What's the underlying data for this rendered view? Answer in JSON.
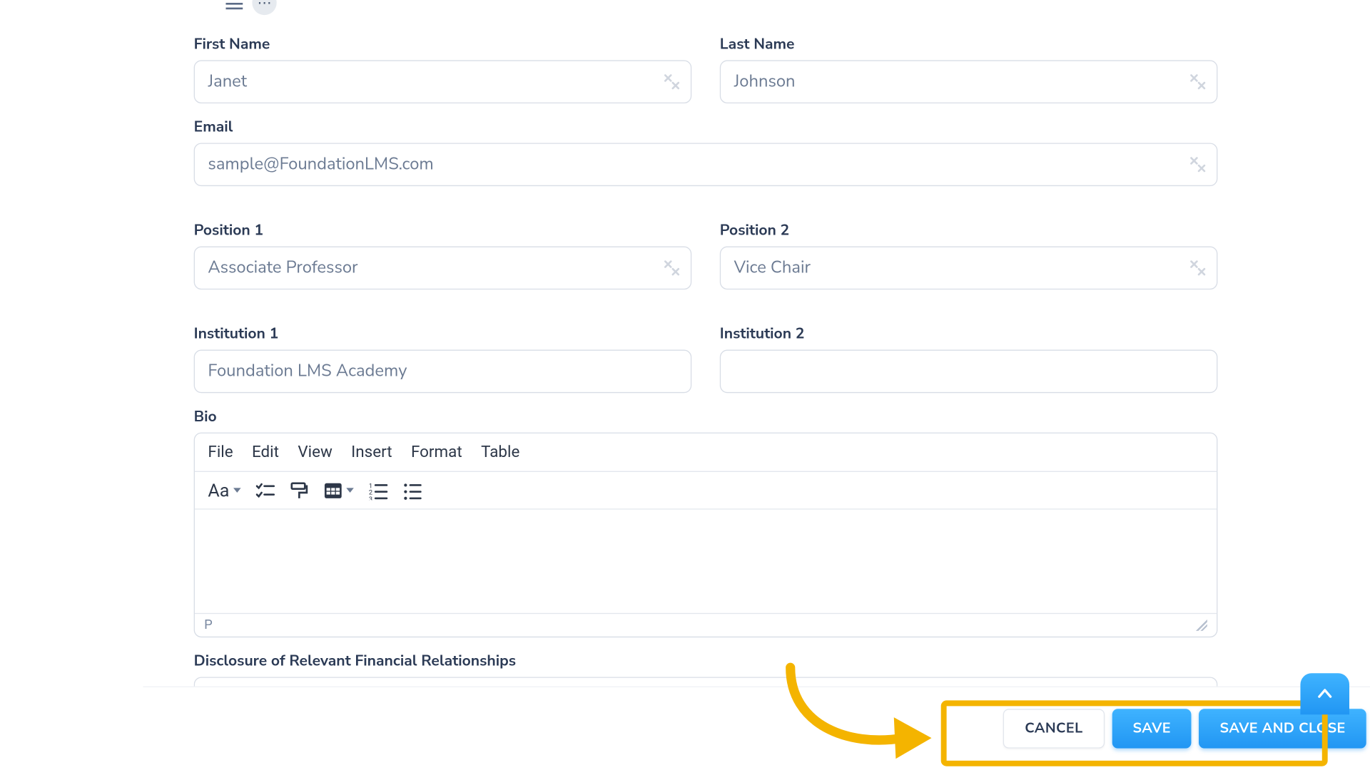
{
  "form": {
    "first_name": {
      "label": "First Name",
      "value": "Janet"
    },
    "last_name": {
      "label": "Last Name",
      "value": "Johnson"
    },
    "email": {
      "label": "Email",
      "value": "sample@FoundationLMS.com"
    },
    "position1": {
      "label": "Position 1",
      "value": "Associate Professor"
    },
    "position2": {
      "label": "Position 2",
      "value": "Vice Chair"
    },
    "institution1": {
      "label": "Institution 1",
      "value": "Foundation LMS Academy"
    },
    "institution2": {
      "label": "Institution 2",
      "value": ""
    },
    "bio_label": "Bio",
    "disclosure_label": "Disclosure of Relevant Financial Relationships"
  },
  "editor": {
    "menu": {
      "file": "File",
      "edit": "Edit",
      "view": "View",
      "insert": "Insert",
      "format": "Format",
      "table": "Table"
    },
    "status_path": "P",
    "font_label": "Aa"
  },
  "footer": {
    "cancel": "CANCEL",
    "save": "SAVE",
    "save_close": "SAVE AND CLOSE"
  }
}
